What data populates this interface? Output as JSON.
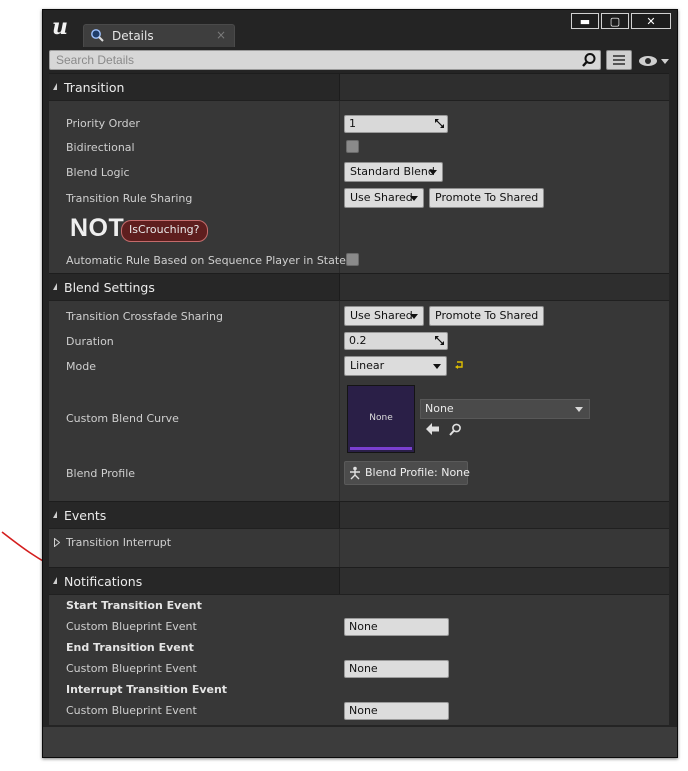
{
  "app": {
    "logo_text": "u"
  },
  "tab": {
    "title": "Details",
    "close_glyph": "×"
  },
  "window_controls": {
    "minimize": "▬",
    "maximize": "▢",
    "close": "✕"
  },
  "search": {
    "placeholder": "Search Details",
    "value": ""
  },
  "icons": {
    "tab": "details-magnifier-icon",
    "search": "search-icon",
    "view_options": "view-options-icon",
    "visibility": "eye-icon",
    "spin": "spin-arrows-icon",
    "reset": "reset-to-default-icon",
    "use_selected": "use-selected-arrow-icon",
    "browse": "browse-icon",
    "blend_profile": "blend-profile-icon"
  },
  "colors": {
    "accent_purple": "#7a3fd0",
    "pill_bg": "#5e1e1e",
    "annotation": "#d41e1e"
  },
  "transition": {
    "title": "Transition",
    "priority_order": {
      "label": "Priority Order",
      "value": "1"
    },
    "bidirectional": {
      "label": "Bidirectional",
      "checked": false
    },
    "blend_logic": {
      "label": "Blend Logic",
      "value": "Standard Blend"
    },
    "rule_sharing": {
      "label": "Transition Rule Sharing",
      "value": "Use Shared",
      "promote": "Promote To Shared"
    },
    "rule_graph": {
      "not_label": "NOT",
      "pill": "IsCrouching?"
    },
    "automatic_rule": {
      "label": "Automatic Rule Based on Sequence Player in State",
      "checked": false
    }
  },
  "blend_settings": {
    "title": "Blend Settings",
    "crossfade_sharing": {
      "label": "Transition Crossfade Sharing",
      "value": "Use Shared",
      "promote": "Promote To Shared"
    },
    "duration": {
      "label": "Duration",
      "value": "0.2"
    },
    "mode": {
      "label": "Mode",
      "value": "Linear"
    },
    "custom_blend_curve": {
      "label": "Custom Blend Curve",
      "thumbnail": "None",
      "value": "None"
    },
    "blend_profile": {
      "label": "Blend Profile",
      "value": "Blend Profile: None"
    }
  },
  "events": {
    "title": "Events",
    "transition_interrupt": {
      "label": "Transition Interrupt"
    }
  },
  "notifications": {
    "title": "Notifications",
    "start": {
      "heading": "Start Transition Event",
      "label": "Custom Blueprint Event",
      "value": "None"
    },
    "end": {
      "heading": "End Transition Event",
      "label": "Custom Blueprint Event",
      "value": "None"
    },
    "interrupt": {
      "heading": "Interrupt Transition Event",
      "label": "Custom Blueprint Event",
      "value": "None"
    }
  }
}
